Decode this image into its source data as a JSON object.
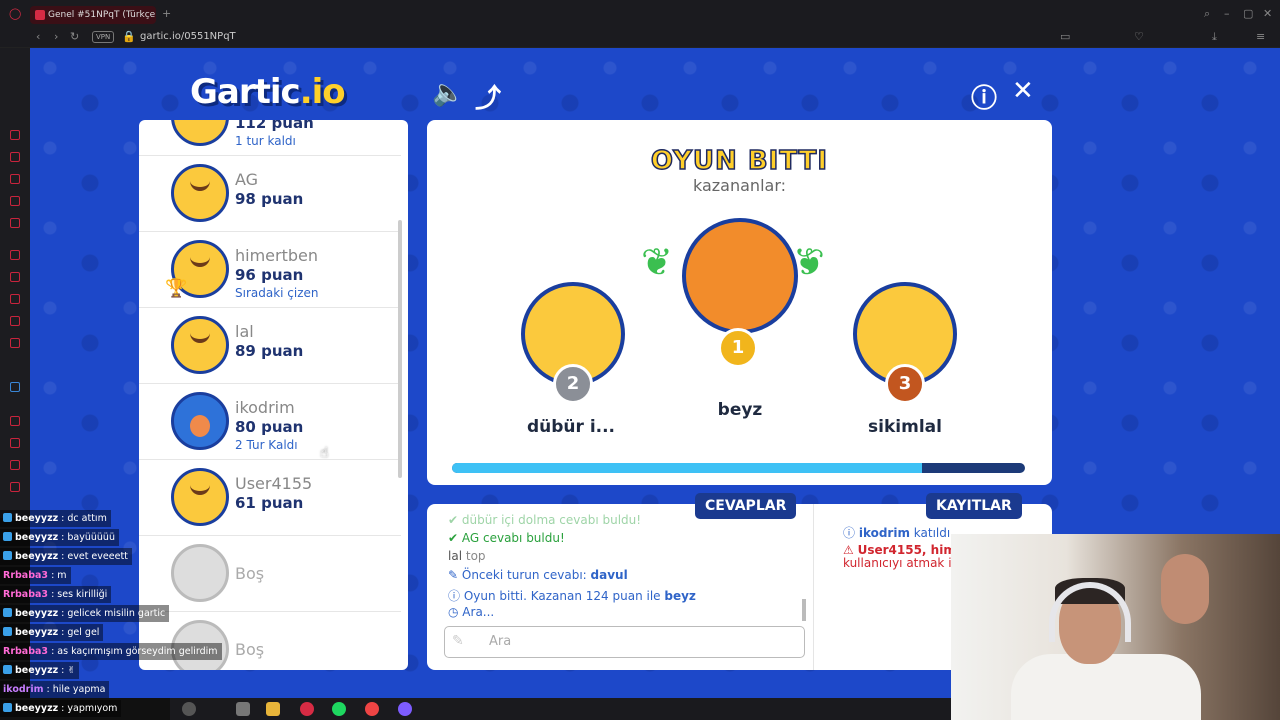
{
  "browser": {
    "tab_title": "Genel #51NPqT (Türkçe)",
    "vpn_badge": "VPN",
    "url": "gartic.io/0551NPqT",
    "new_tab_icon": "plus-icon"
  },
  "game": {
    "logo_text": "Gartic",
    "logo_suffix": ".io",
    "top_icons": [
      "sound-icon",
      "share-icon",
      "info-icon",
      "close-icon"
    ]
  },
  "players": [
    {
      "name": "",
      "points": "112 puan",
      "note": "1 tur kaldı"
    },
    {
      "name": "AG",
      "points": "98 puan",
      "note": ""
    },
    {
      "name": "himertben",
      "points": "96 puan",
      "note": "Sıradaki çizen"
    },
    {
      "name": "lal",
      "points": "89 puan",
      "note": ""
    },
    {
      "name": "ikodrim",
      "points": "80 puan",
      "note": "2 Tur Kaldı"
    },
    {
      "name": "User4155",
      "points": "61 puan",
      "note": ""
    },
    {
      "name": "Boş",
      "points": "",
      "note": ""
    },
    {
      "name": "Boş",
      "points": "",
      "note": ""
    }
  ],
  "result": {
    "title": "OYUN BITTI",
    "subtitle": "kazananlar:",
    "first": {
      "name": "beyz",
      "rank": "1"
    },
    "second": {
      "name": "dübür i...",
      "rank": "2"
    },
    "third": {
      "name": "sikimlal",
      "rank": "3"
    },
    "progress_fraction": 0.82
  },
  "answers": {
    "header": "CEVAPLAR",
    "messages": [
      {
        "icon": "check-icon",
        "text": "dübür içi dolma cevabı buldu!"
      },
      {
        "icon": "check-icon",
        "text": "AG cevabı buldu!"
      },
      {
        "icon": "",
        "user": "lal",
        "text": "top"
      },
      {
        "icon": "pencil-icon",
        "text": "Önceki turun cevabı:",
        "bold": "davul"
      },
      {
        "icon": "info-icon",
        "text": "Oyun bitti. Kazanan 124 puan ile",
        "bold": "beyz"
      },
      {
        "icon": "clock-icon",
        "text": "Ara..."
      }
    ],
    "input_placeholder": "Ara"
  },
  "logs": {
    "header": "KAYITLAR",
    "entries": [
      {
        "user": "ikodrim",
        "text": "katıldı",
        "color": "#2f64c8"
      },
      {
        "user": "User4155, hime",
        "text": "",
        "color": "#d1262f"
      },
      {
        "user": "",
        "text": "kullanıcıyı atmak içi",
        "color": "#d1262f"
      }
    ]
  },
  "chat": [
    {
      "user": "beeyyzz",
      "text": ": dc attım",
      "color": "#ffffff",
      "icon": true
    },
    {
      "user": "beeyyzz",
      "text": ": bayüüüüü",
      "color": "#ffffff",
      "icon": true
    },
    {
      "user": "beeyyzz",
      "text": ": evet eveeett",
      "color": "#ffffff",
      "icon": true
    },
    {
      "user": "Rrbaba3",
      "text": ": m",
      "color": "#ff6ad5",
      "icon": false
    },
    {
      "user": "Rrbaba3",
      "text": ": ses kirilliği",
      "color": "#ff6ad5",
      "icon": false
    },
    {
      "user": "beeyyzz",
      "text": ": gelicek misilin gartic",
      "color": "#ffffff",
      "icon": true
    },
    {
      "user": "beeyyzz",
      "text": ": gel gel",
      "color": "#ffffff",
      "icon": true
    },
    {
      "user": "Rrbaba3",
      "text": ": as kaçırmışım görseydim gelirdim",
      "color": "#ff6ad5",
      "icon": false
    },
    {
      "user": "beeyyzz",
      "text": ": ✌",
      "color": "#ffffff",
      "icon": true
    },
    {
      "user": "ikodrim",
      "text": ": hile yapma",
      "color": "#c77dff",
      "icon": false
    },
    {
      "user": "beeyyzz",
      "text": ": yapmıyom",
      "color": "#ffffff",
      "icon": true
    }
  ],
  "colors": {
    "game_bg": "#1d48c9",
    "accent_yellow": "#ffcf2a",
    "nav_blue": "#1b3a8f",
    "progress": "#3ec1f5"
  }
}
